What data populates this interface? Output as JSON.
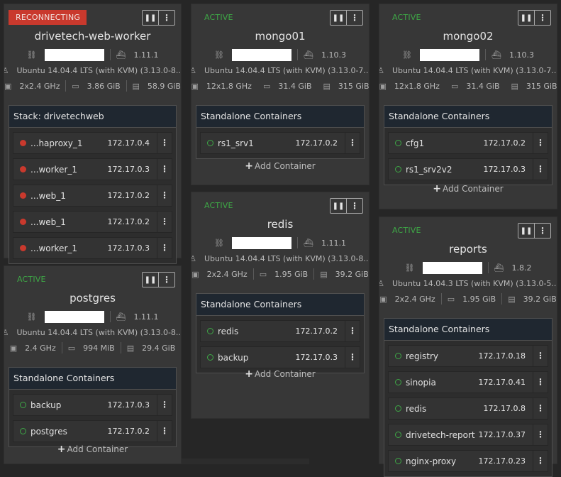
{
  "hosts": [
    {
      "status": "RECONNECTING",
      "name": "drivetech-web-worker",
      "docker_version": "1.11.1",
      "os": "Ubuntu 14.04.4 LTS (with KVM) (3.13.0-8...",
      "cpu": "2x2.4 GHz",
      "ram": "3.86 GiB",
      "disk": "58.9 GiB",
      "stack_title": "Stack: drivetechweb",
      "containers": [
        {
          "name": "...haproxy_1",
          "ip": "172.17.0.4",
          "state": "stopped"
        },
        {
          "name": "...worker_1",
          "ip": "172.17.0.3",
          "state": "stopped"
        },
        {
          "name": "...web_1",
          "ip": "172.17.0.2",
          "state": "stopped"
        },
        {
          "name": "...web_1",
          "ip": "172.17.0.2",
          "state": "stopped"
        },
        {
          "name": "...worker_1",
          "ip": "172.17.0.3",
          "state": "stopped"
        }
      ]
    },
    {
      "status": "ACTIVE",
      "name": "mongo01",
      "docker_version": "1.10.3",
      "os": "Ubuntu 14.04.4 LTS (with KVM) (3.13.0-7...",
      "cpu": "12x1.8 GHz",
      "ram": "31.4 GiB",
      "disk": "315 GiB",
      "stack_title": "Standalone Containers",
      "containers": [
        {
          "name": "rs1_srv1",
          "ip": "172.17.0.2",
          "state": "running"
        }
      ],
      "add_label": "Add Container"
    },
    {
      "status": "ACTIVE",
      "name": "mongo02",
      "docker_version": "1.10.3",
      "os": "Ubuntu 14.04.4 LTS (with KVM) (3.13.0-7...",
      "cpu": "12x1.8 GHz",
      "ram": "31.4 GiB",
      "disk": "315 GiB",
      "stack_title": "Standalone Containers",
      "containers": [
        {
          "name": "cfg1",
          "ip": "172.17.0.2",
          "state": "running"
        },
        {
          "name": "rs1_srv2v2",
          "ip": "172.17.0.3",
          "state": "running"
        }
      ],
      "add_label": "Add Container"
    },
    {
      "status": "ACTIVE",
      "name": "postgres",
      "docker_version": "1.11.1",
      "os": "Ubuntu 14.04.4 LTS (with KVM) (3.13.0-8...",
      "cpu": "2.4 GHz",
      "ram": "994 MiB",
      "disk": "29.4 GiB",
      "stack_title": "Standalone Containers",
      "containers": [
        {
          "name": "backup",
          "ip": "172.17.0.3",
          "state": "running"
        },
        {
          "name": "postgres",
          "ip": "172.17.0.2",
          "state": "running"
        }
      ],
      "add_label": "Add Container"
    },
    {
      "status": "ACTIVE",
      "name": "redis",
      "docker_version": "1.11.1",
      "os": "Ubuntu 14.04.4 LTS (with KVM) (3.13.0-8...",
      "cpu": "2x2.4 GHz",
      "ram": "1.95 GiB",
      "disk": "39.2 GiB",
      "stack_title": "Standalone Containers",
      "containers": [
        {
          "name": "redis",
          "ip": "172.17.0.2",
          "state": "running"
        },
        {
          "name": "backup",
          "ip": "172.17.0.3",
          "state": "running"
        }
      ],
      "add_label": "Add Container"
    },
    {
      "status": "ACTIVE",
      "name": "reports",
      "docker_version": "1.8.2",
      "os": "Ubuntu 14.04.3 LTS (with KVM) (3.13.0-5...",
      "cpu": "2x2.4 GHz",
      "ram": "1.95 GiB",
      "disk": "39.2 GiB",
      "stack_title": "Standalone Containers",
      "containers": [
        {
          "name": "registry",
          "ip": "172.17.0.18",
          "state": "running"
        },
        {
          "name": "sinopia",
          "ip": "172.17.0.41",
          "state": "running"
        },
        {
          "name": "redis",
          "ip": "172.17.0.8",
          "state": "running"
        },
        {
          "name": "drivetech-report",
          "ip": "172.17.0.37",
          "state": "running"
        },
        {
          "name": "nginx-proxy",
          "ip": "172.17.0.23",
          "state": "running"
        }
      ]
    }
  ],
  "icons": {
    "pause": "pause-icon",
    "menu": "kebab-icon",
    "ip": "link-icon",
    "docker": "docker-icon",
    "os": "linux-icon",
    "cpu": "cpu-icon",
    "ram": "ram-icon",
    "disk": "disk-icon",
    "add": "plus-icon"
  },
  "colors": {
    "reconnecting": "#c9392d",
    "active": "#3ea846",
    "stopped_dot": "#c9392d",
    "running_dot": "#3ea846"
  }
}
